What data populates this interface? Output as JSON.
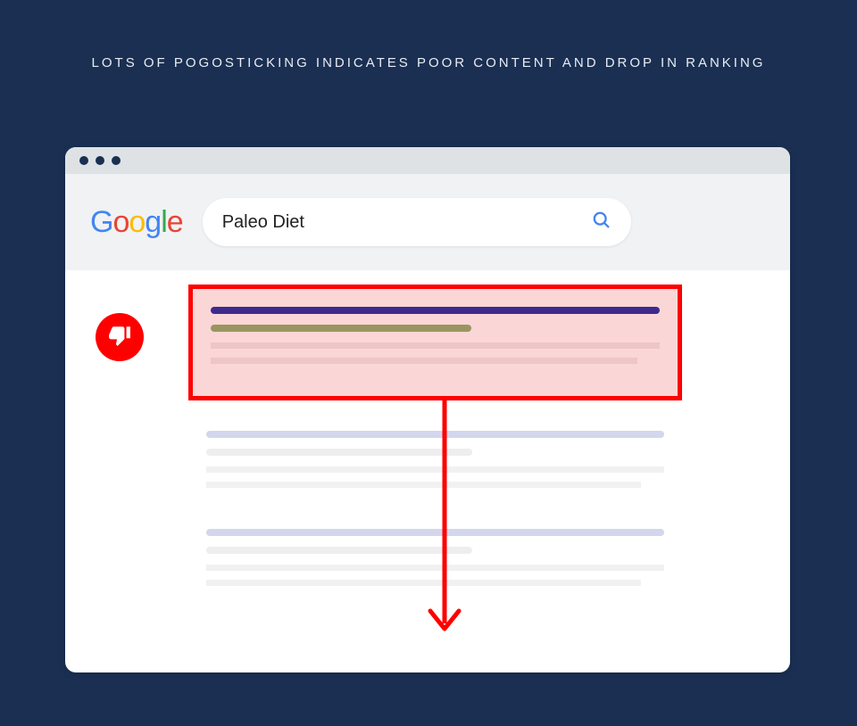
{
  "heading": "LOTS OF POGOSTICKING INDICATES POOR CONTENT AND DROP IN RANKING",
  "logo": {
    "letters": [
      "G",
      "o",
      "o",
      "g",
      "l",
      "e"
    ]
  },
  "search": {
    "query": "Paleo Diet",
    "icon": "search-icon"
  },
  "badge": {
    "icon": "thumbs-down-icon"
  },
  "results": {
    "highlighted": {
      "index": 1
    },
    "faded": [
      {
        "index": 2
      },
      {
        "index": 3
      }
    ]
  },
  "colors": {
    "background": "#1a2f52",
    "highlight_border": "#ff0000",
    "highlight_fill": "#fbd6d6",
    "badge": "#ff0000",
    "title_line": "#3d2a8f",
    "url_line": "#9a9560"
  }
}
